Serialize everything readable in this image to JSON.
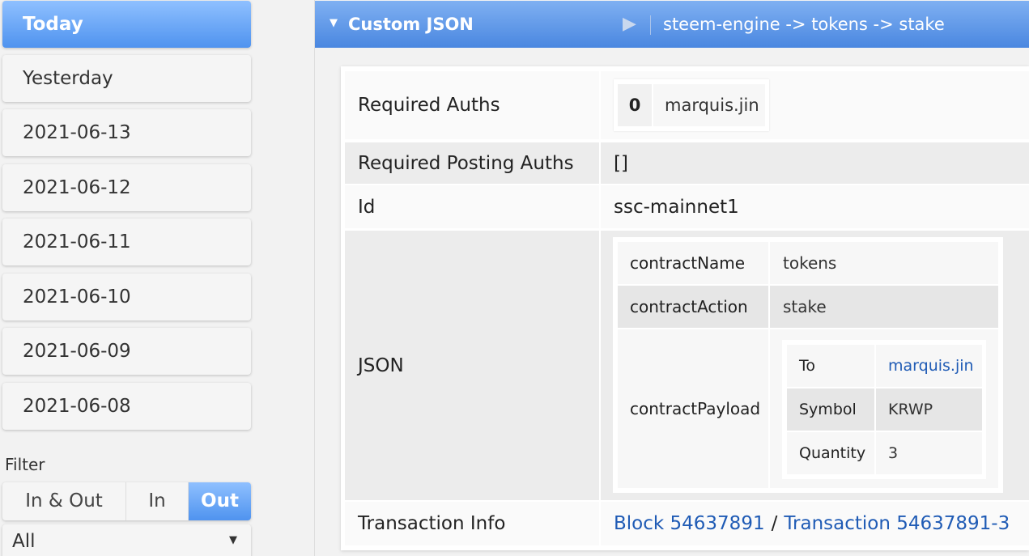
{
  "sidebar": {
    "days": [
      "Today",
      "Yesterday",
      "2021-06-13",
      "2021-06-12",
      "2021-06-11",
      "2021-06-10",
      "2021-06-09",
      "2021-06-08"
    ],
    "filter_label": "Filter",
    "filter_options": [
      "In & Out",
      "In",
      "Out"
    ],
    "selected_filter": "Out",
    "type_select": "All"
  },
  "panel": {
    "title": "Custom JSON",
    "path": "steem-engine -> tokens -> stake"
  },
  "fields": {
    "required_auths_label": "Required Auths",
    "required_auths_index": "0",
    "required_auths_value": "marquis.jin",
    "required_posting_auths_label": "Required Posting Auths",
    "required_posting_auths_value": "[]",
    "id_label": "Id",
    "id_value": "ssc-mainnet1",
    "json_label": "JSON",
    "transaction_info_label": "Transaction Info",
    "block_link": "Block 54637891",
    "separator": "/",
    "transaction_link": "Transaction 54637891-3"
  },
  "json": {
    "contract_name_key": "contractName",
    "contract_name_value": "tokens",
    "contract_action_key": "contractAction",
    "contract_action_value": "stake",
    "contract_payload_key": "contractPayload",
    "payload": {
      "to_key": "To",
      "to_value": "marquis.jin",
      "symbol_key": "Symbol",
      "symbol_value": "KRWP",
      "quantity_key": "Quantity",
      "quantity_value": "3"
    }
  },
  "colors": {
    "accent": "#4f93ef",
    "link": "#1f5bb5"
  }
}
